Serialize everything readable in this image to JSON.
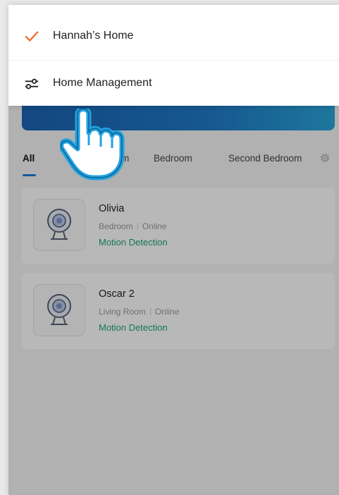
{
  "home_switcher": {
    "items": [
      {
        "label": "Hannah’s Home",
        "icon": "checkmark-icon",
        "selected": true
      },
      {
        "label": "Home Management",
        "icon": "sliders-icon"
      }
    ],
    "check_color": "#f0642a"
  },
  "tabs": {
    "items": [
      "All",
      "m",
      "Bedroom",
      "Second Bedroom"
    ],
    "active_index": 0,
    "settings_icon": "gear-icon"
  },
  "devices": [
    {
      "name": "Olivia",
      "room": "Bedroom",
      "connection": "Online",
      "status": "Motion Detection",
      "icon": "camera-icon"
    },
    {
      "name": "Oscar 2",
      "room": "Living Room",
      "connection": "Online",
      "status": "Motion Detection",
      "icon": "camera-icon"
    }
  ],
  "colors": {
    "accent_blue": "#1e7ad6",
    "status_green": "#1aa672"
  },
  "pointer": {
    "icon": "tap-hand-icon"
  }
}
